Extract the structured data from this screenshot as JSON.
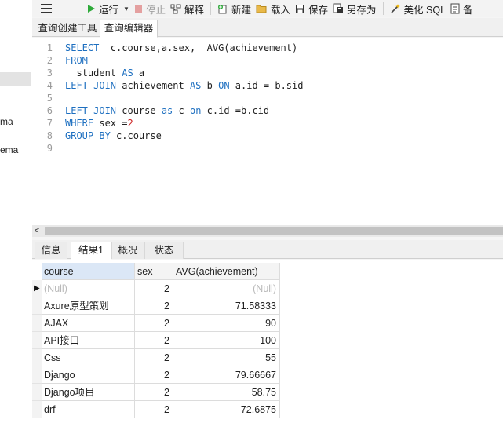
{
  "nav": {
    "fragments": [
      "ma",
      "ema"
    ]
  },
  "toolbar": {
    "run_label": "运行",
    "stop_label": "停止",
    "explain_label": "解释",
    "new_label": "新建",
    "load_label": "载入",
    "save_label": "保存",
    "saveas_label": "另存为",
    "beautify_label": "美化 SQL",
    "more_label": "备"
  },
  "tabs": [
    {
      "label": "查询创建工具",
      "active": false
    },
    {
      "label": "查询编辑器",
      "active": true
    }
  ],
  "editor": {
    "line_numbers": [
      "1",
      "2",
      "3",
      "4",
      "5",
      "6",
      "7",
      "8",
      "9"
    ]
  },
  "result_tabs": [
    {
      "label": "信息",
      "active": false
    },
    {
      "label": "结果1",
      "active": true
    },
    {
      "label": "概况",
      "active": false
    },
    {
      "label": "状态",
      "active": false
    }
  ],
  "grid": {
    "columns": [
      "course",
      "sex",
      "AVG(achievement)"
    ],
    "rows": [
      {
        "course": "(Null)",
        "sex": "2",
        "avg": "(Null)",
        "current": true
      },
      {
        "course": " Axure原型策划",
        "sex": "2",
        "avg": "71.58333"
      },
      {
        "course": "AJAX",
        "sex": "2",
        "avg": "90"
      },
      {
        "course": "API接口",
        "sex": "2",
        "avg": "100"
      },
      {
        "course": "Css",
        "sex": "2",
        "avg": "55"
      },
      {
        "course": "Django",
        "sex": "2",
        "avg": "79.66667"
      },
      {
        "course": "Django项目",
        "sex": "2",
        "avg": "58.75"
      },
      {
        "course": "drf",
        "sex": "2",
        "avg": "72.6875"
      }
    ]
  },
  "colors": {
    "keyword": "#1d6fc0",
    "number": "#cc2222",
    "null_text": "#b9b9b9",
    "header_selected": "#dbe7f6"
  }
}
